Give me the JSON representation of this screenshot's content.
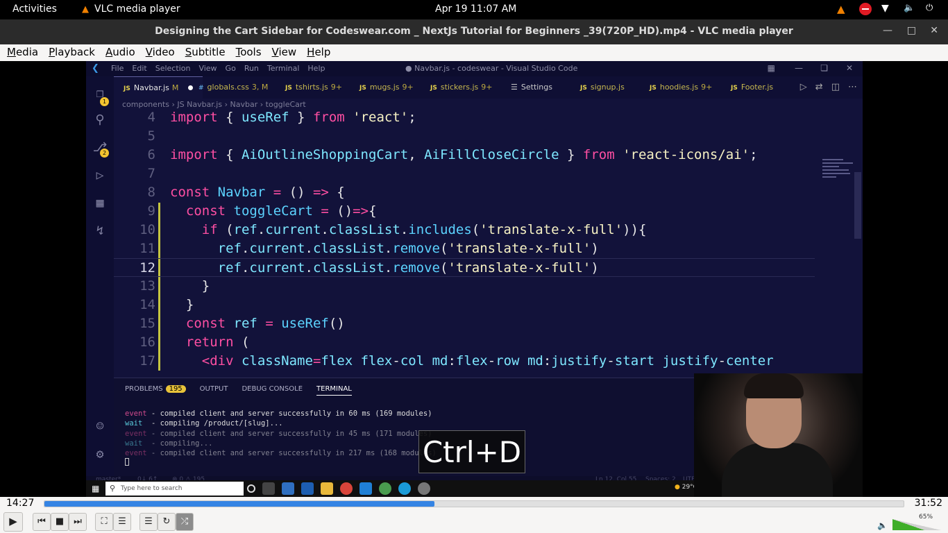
{
  "topbar": {
    "activities": "Activities",
    "app_name": "VLC media player",
    "clock": "Apr 19  11:07 AM"
  },
  "window": {
    "title": "Designing the Cart Sidebar for Codeswear.com _ NextJs Tutorial for Beginners _39(720P_HD).mp4 - VLC media player"
  },
  "menu": [
    "Media",
    "Playback",
    "Audio",
    "Video",
    "Subtitle",
    "Tools",
    "View",
    "Help"
  ],
  "vscode": {
    "menus": [
      "File",
      "Edit",
      "Selection",
      "View",
      "Go",
      "Run",
      "Terminal",
      "Help"
    ],
    "window_title": "● Navbar.js - codeswear - Visual Studio Code",
    "activity_badges": {
      "explorer": "1",
      "scm": "2"
    },
    "tabs": [
      {
        "icon": "JS",
        "label": "Navbar.js",
        "meta": "M",
        "active": true
      },
      {
        "icon": "#",
        "label": "globals.css",
        "meta": "3, M"
      },
      {
        "icon": "JS",
        "label": "tshirts.js",
        "meta": "9+"
      },
      {
        "icon": "JS",
        "label": "mugs.js",
        "meta": "9+"
      },
      {
        "icon": "JS",
        "label": "stickers.js",
        "meta": "9+"
      },
      {
        "icon": "☰",
        "label": "Settings",
        "meta": ""
      },
      {
        "icon": "JS",
        "label": "signup.js",
        "meta": ""
      },
      {
        "icon": "JS",
        "label": "hoodies.js",
        "meta": "9+"
      },
      {
        "icon": "JS",
        "label": "Footer.js",
        "meta": ""
      }
    ],
    "breadcrumb": [
      "components",
      "JS Navbar.js",
      "Navbar",
      "toggleCart"
    ],
    "code_lines": [
      {
        "num": "4",
        "text": "import { useRef } from 'react';"
      },
      {
        "num": "5",
        "text": ""
      },
      {
        "num": "6",
        "text": "import { AiOutlineShoppingCart, AiFillCloseCircle } from 'react-icons/ai';"
      },
      {
        "num": "7",
        "text": ""
      },
      {
        "num": "8",
        "text": "const Navbar = () => {"
      },
      {
        "num": "9",
        "text": "  const toggleCart = ()=>{"
      },
      {
        "num": "10",
        "text": "    if (ref.current.classList.includes('translate-x-full')){"
      },
      {
        "num": "11",
        "text": "      ref.current.classList.remove('translate-x-full')"
      },
      {
        "num": "12",
        "text": "      ref.current.classList.remove('translate-x-full')"
      },
      {
        "num": "13",
        "text": "    }"
      },
      {
        "num": "14",
        "text": "  }"
      },
      {
        "num": "15",
        "text": "  const ref = useRef()"
      },
      {
        "num": "16",
        "text": "  return ("
      },
      {
        "num": "17",
        "text": "    <div className='flex flex-col md:flex-row md:justify-start justify-center"
      }
    ],
    "panel": {
      "tabs": [
        "PROBLEMS",
        "OUTPUT",
        "DEBUG CONSOLE",
        "TERMINAL"
      ],
      "problems_count": "195",
      "active_tab": "TERMINAL",
      "terminal": [
        {
          "level": "event",
          "msg": " - compiled client and server successfully in 60 ms (169 modules)"
        },
        {
          "level": "wait",
          "msg": "  - compiling /product/[slug]..."
        },
        {
          "level": "event",
          "msg": " - compiled client and server successfully in 45 ms (171 modules)"
        },
        {
          "level": "wait",
          "msg": "  - compiling..."
        },
        {
          "level": "event",
          "msg": " - compiled client and server successfully in 217 ms (168 modules)"
        }
      ]
    },
    "status": {
      "branch": "master*",
      "sync": "0↓ 6↑",
      "problems": "⊗ 0 ⚠ 195",
      "position": "Ln 12, Col 55",
      "spaces": "Spaces: 2",
      "encoding": "UTF-8"
    }
  },
  "windows_taskbar": {
    "search_placeholder": "Type here to search",
    "weather": "29°C"
  },
  "osd_shortcut": "Ctrl+D",
  "player": {
    "elapsed": "14:27",
    "total": "31:52",
    "progress_fraction": 0.454,
    "volume_label": "65%",
    "volume_fraction": 0.65,
    "accent": "#3584e4",
    "volume_color": "#3fae29"
  }
}
